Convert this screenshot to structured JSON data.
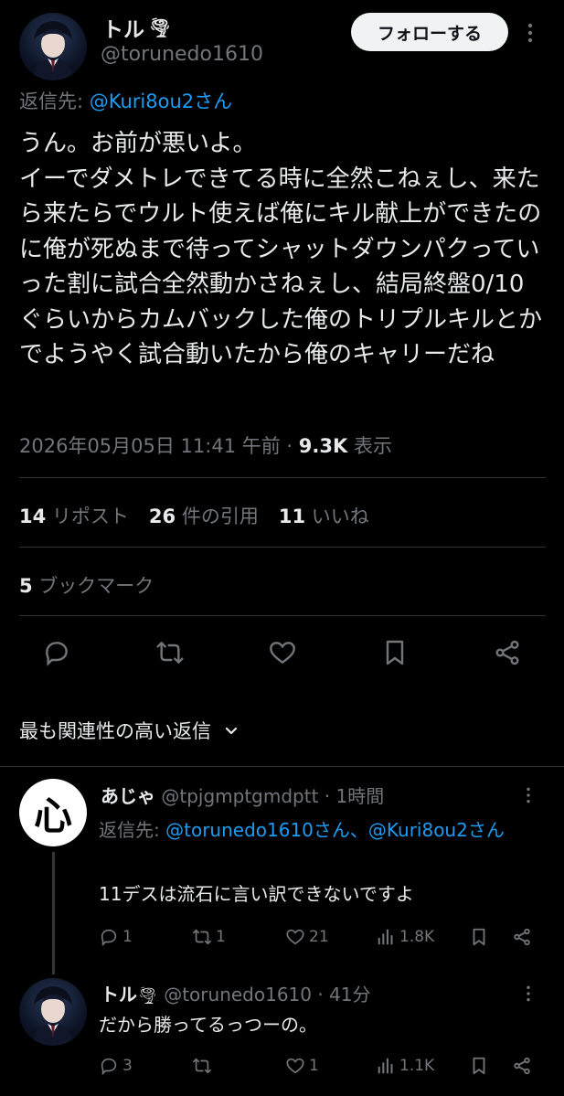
{
  "main_tweet": {
    "author_name": "トル",
    "author_emoji": "🌪",
    "handle": "@torunedo1610",
    "follow_label": "フォローする",
    "reply_to_prefix": "返信先: ",
    "reply_to_handle": "@Kuri8ou2さん",
    "text": "うん。お前が悪いよ。\nイーでダメトレできてる時に全然こねぇし、来たら来たらでウルト使えば俺にキル献上ができたのに俺が死ぬまで待ってシャットダウンパクっていった割に試合全然動かさねぇし、結局終盤0/10ぐらいからカムバックした俺のトリプルキルとかでようやく試合動いたから俺のキャリーだね",
    "timestamp": "2026年05月05日 11:41 午前 · ",
    "views_count": "9.3K",
    "views_label": " 表示",
    "stats": {
      "reposts_count": "14",
      "reposts_label": "リポスト",
      "quotes_count": "26",
      "quotes_label": "件の引用",
      "likes_count": "11",
      "likes_label": "いいね",
      "bookmarks_count": "5",
      "bookmarks_label": "ブックマーク"
    }
  },
  "replies_sort": {
    "label": "最も関連性の高い返信"
  },
  "replies": [
    {
      "avatar_char": "心",
      "author_name": "あじゃ",
      "handle_time": "@tpjgmptgmdptt · 1時間",
      "reply_to_prefix": "返信先: ",
      "reply_to_handles": "@torunedo1610さん、@Kuri8ou2さん",
      "text": "11デスは流石に言い訳できないですよ",
      "actions": {
        "replies": "1",
        "reposts": "1",
        "likes": "21",
        "views": "1.8K"
      }
    },
    {
      "author_name": "トル",
      "author_emoji": "🌪",
      "handle_time": "@torunedo1610 · 41分",
      "text": "だから勝ってるっつーの。",
      "actions": {
        "replies": "3",
        "reposts": "",
        "likes": "1",
        "views": "1.1K"
      }
    }
  ]
}
